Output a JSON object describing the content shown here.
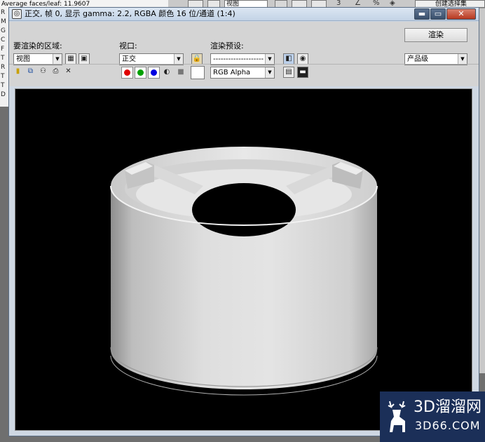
{
  "background_app": {
    "info_text": "Average faces/leaf: 11.9607",
    "view_dropdown": "视图",
    "create_selection_label": "创建选择集",
    "left_column_text": "R\nM\nG\nC\nF\nT\nR\nT\nT\nD"
  },
  "frame_window": {
    "title": "正交, 帧 0, 显示 gamma: 2.2, RGBA 颜色 16 位/通道 (1:4)",
    "minimize_icon": "▬",
    "maximize_icon": "▭",
    "close_icon": "✕"
  },
  "toolbar": {
    "area_label": "要渲染的区域:",
    "area_value": "视图",
    "viewport_label": "视口:",
    "viewport_value": "正交",
    "preset_label": "渲染预设:",
    "preset_value": "--------------------",
    "render_button": "渲染",
    "quality_value": "产品级",
    "channel_value": "RGB Alpha"
  },
  "colors": {
    "red_channel": "#e00000",
    "green_channel": "#00a000",
    "blue_channel": "#0000e0",
    "viewport_bg": "#000000",
    "watermark_bg": "#1b2f58"
  },
  "watermark": {
    "line1": "3D溜溜网",
    "line2": "3D66.COM"
  }
}
